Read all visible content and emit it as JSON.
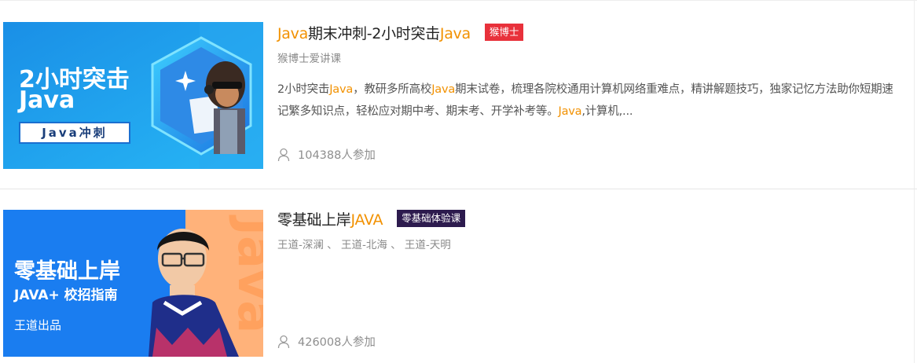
{
  "courses": [
    {
      "title_parts": [
        {
          "text": "Java",
          "highlight": true
        },
        {
          "text": "期末冲刺-2小时突击",
          "highlight": false
        },
        {
          "text": "Java",
          "highlight": true
        }
      ],
      "badge": "猴博士",
      "badge_color": "#e8313b",
      "teacher": "猴博士爱讲课",
      "description_parts": [
        {
          "text": "2小时突击",
          "highlight": false
        },
        {
          "text": "Java",
          "highlight": true
        },
        {
          "text": "，教研多所高校",
          "highlight": false
        },
        {
          "text": "Java",
          "highlight": true
        },
        {
          "text": "期末试卷，梳理各院校通用计算机网络重难点，精讲解题技巧，独家记忆方法助你短期速记繁多知识点，轻松应对期中考、期末考、开学补考等。",
          "highlight": false
        },
        {
          "text": "Java",
          "highlight": true
        },
        {
          "text": ",计算机,...",
          "highlight": false
        }
      ],
      "participants": "104388人参加",
      "thumbnail": {
        "line1": "2小时突击",
        "line2": "Java",
        "tag": "Java冲刺"
      }
    },
    {
      "title_parts": [
        {
          "text": "零基础上岸",
          "highlight": false
        },
        {
          "text": "JAVA",
          "highlight": true
        }
      ],
      "badge": "零基础体验课",
      "badge_color": "#2d1b4e",
      "teacher": "王道-深澜 、 王道-北海 、 王道-天明",
      "description_parts": [],
      "participants": "426008人参加",
      "thumbnail": {
        "line1": "零基础上岸",
        "line2": "JAVA+ 校招指南",
        "line3": "王道出品",
        "side_text": "Java"
      }
    }
  ],
  "colors": {
    "accent": "#f29100",
    "muted": "#8a8a8a"
  },
  "icons": {
    "participants": "person-icon"
  }
}
